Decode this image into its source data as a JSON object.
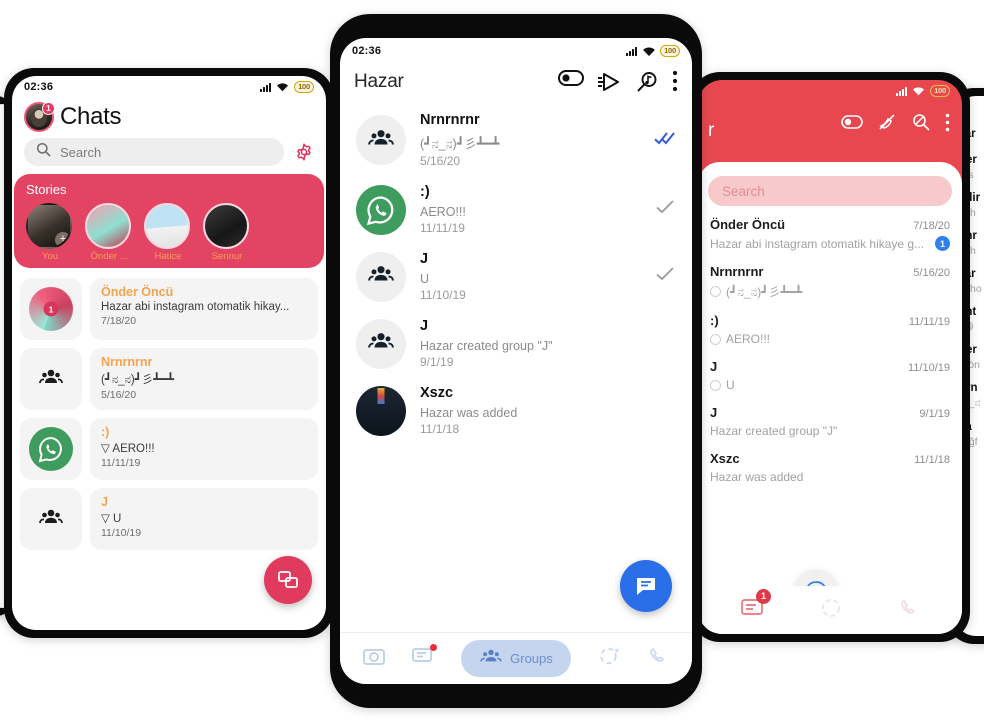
{
  "status": {
    "time": "02:36",
    "battery": "100",
    "wifi_icon": "wifi-icon",
    "signal_icon": "signal-icon"
  },
  "left_phone": {
    "title": "Chats",
    "avatar_badge": "1",
    "search": {
      "placeholder": "Search",
      "icon": "search-icon"
    },
    "settings_icon": "gear-icon",
    "stories": {
      "heading": "Stories",
      "items": [
        {
          "label": "You",
          "add": "+"
        },
        {
          "label": "Önder ..."
        },
        {
          "label": "Hatice"
        },
        {
          "label": "Sennur"
        }
      ]
    },
    "chats": [
      {
        "name": "Önder Öncü",
        "message": "Hazar abi instagram otomatik hikay...",
        "date": "7/18/20",
        "avatar": "photo-avatar",
        "unread": "1"
      },
      {
        "name": "Nrnrnrnr",
        "message": "(┛ನ_ನ)┛彡┻━┻",
        "date": "5/16/20",
        "avatar": "group-icon"
      },
      {
        "name": ":)",
        "message": "▽ AERO!!!",
        "date": "11/11/19",
        "avatar": "whatsapp-avatar"
      },
      {
        "name": "J",
        "message": "▽ U",
        "date": "11/10/19",
        "avatar": "group-icon"
      }
    ],
    "fab_icon": "new-chat-icon"
  },
  "center_phone": {
    "title": "Hazar",
    "header_icons": [
      "toggle-switch-icon",
      "broadcast-icon",
      "music-search-icon",
      "overflow-menu-icon"
    ],
    "chats": [
      {
        "name": "Nrnrnrnr",
        "message": "(┛ನ_ನ)┛彡┻━┻",
        "date": "5/16/20",
        "avatar": "group-icon",
        "tick": "double-check-icon"
      },
      {
        "name": ":)",
        "message": "AERO!!!",
        "date": "11/11/19",
        "avatar": "whatsapp-avatar",
        "tick": "single-check-icon"
      },
      {
        "name": "J",
        "message": "U",
        "date": "11/10/19",
        "avatar": "group-icon",
        "tick": "single-check-icon"
      },
      {
        "name": "J",
        "message": "Hazar created group \"J\"",
        "date": "9/1/19",
        "avatar": "group-icon",
        "tick": ""
      },
      {
        "name": "Xszc",
        "message": "Hazar was added",
        "date": "11/1/18",
        "avatar": "dark-photo-avatar",
        "tick": ""
      }
    ],
    "fab_icon": "message-icon",
    "nav": [
      {
        "icon": "camera-icon",
        "label": "",
        "active": false,
        "badge": false
      },
      {
        "icon": "chats-icon",
        "label": "",
        "active": false,
        "badge": true
      },
      {
        "icon": "groups-icon",
        "label": "Groups",
        "active": true,
        "badge": false
      },
      {
        "icon": "status-icon",
        "label": "",
        "active": false,
        "badge": false
      },
      {
        "icon": "calls-icon",
        "label": "",
        "active": false,
        "badge": false
      }
    ]
  },
  "right_phone": {
    "title": "r",
    "header_icons": [
      "toggle-switch-icon",
      "mute-icon",
      "search-off-icon",
      "overflow-menu-icon"
    ],
    "search": {
      "placeholder": "Search"
    },
    "chats": [
      {
        "name": "Önder Öncü",
        "message": "Hazar abi instagram otomatik hikaye g...",
        "date": "7/18/20",
        "unread": "1"
      },
      {
        "name": "Nrnrnrnr",
        "message": "(┛ನ_ನ)┛彡┻━┻",
        "date": "5/16/20",
        "unread": ""
      },
      {
        "name": ":)",
        "message": "AERO!!!",
        "date": "11/11/19",
        "unread": ""
      },
      {
        "name": "J",
        "message": "U",
        "date": "11/10/19",
        "unread": ""
      },
      {
        "name": "J",
        "message": "Hazar created group \"J\"",
        "date": "9/1/19",
        "unread": ""
      },
      {
        "name": "Xszc",
        "message": "Hazar was added",
        "date": "11/1/18",
        "unread": ""
      }
    ],
    "fab_icon": "whatsapp-icon",
    "nav_badge": "1",
    "nav": [
      "chats-icon",
      "status-icon",
      "calls-icon"
    ]
  },
  "back_phone": {
    "rows": [
      {
        "name": "zar",
        "message": ""
      },
      {
        "name": "ner",
        "message": "ıls"
      },
      {
        "name": "edir",
        "message": "Ph"
      },
      {
        "name": "ehr",
        "message": "Ph"
      },
      {
        "name": "zar",
        "message": "Pho"
      },
      {
        "name": "eht",
        "message": "😄"
      },
      {
        "name": "ner",
        "message": "yön"
      },
      {
        "name": "nrn",
        "message": "ನ_ನ"
      },
      {
        "name": "lla",
        "message": "ağf"
      }
    ]
  }
}
